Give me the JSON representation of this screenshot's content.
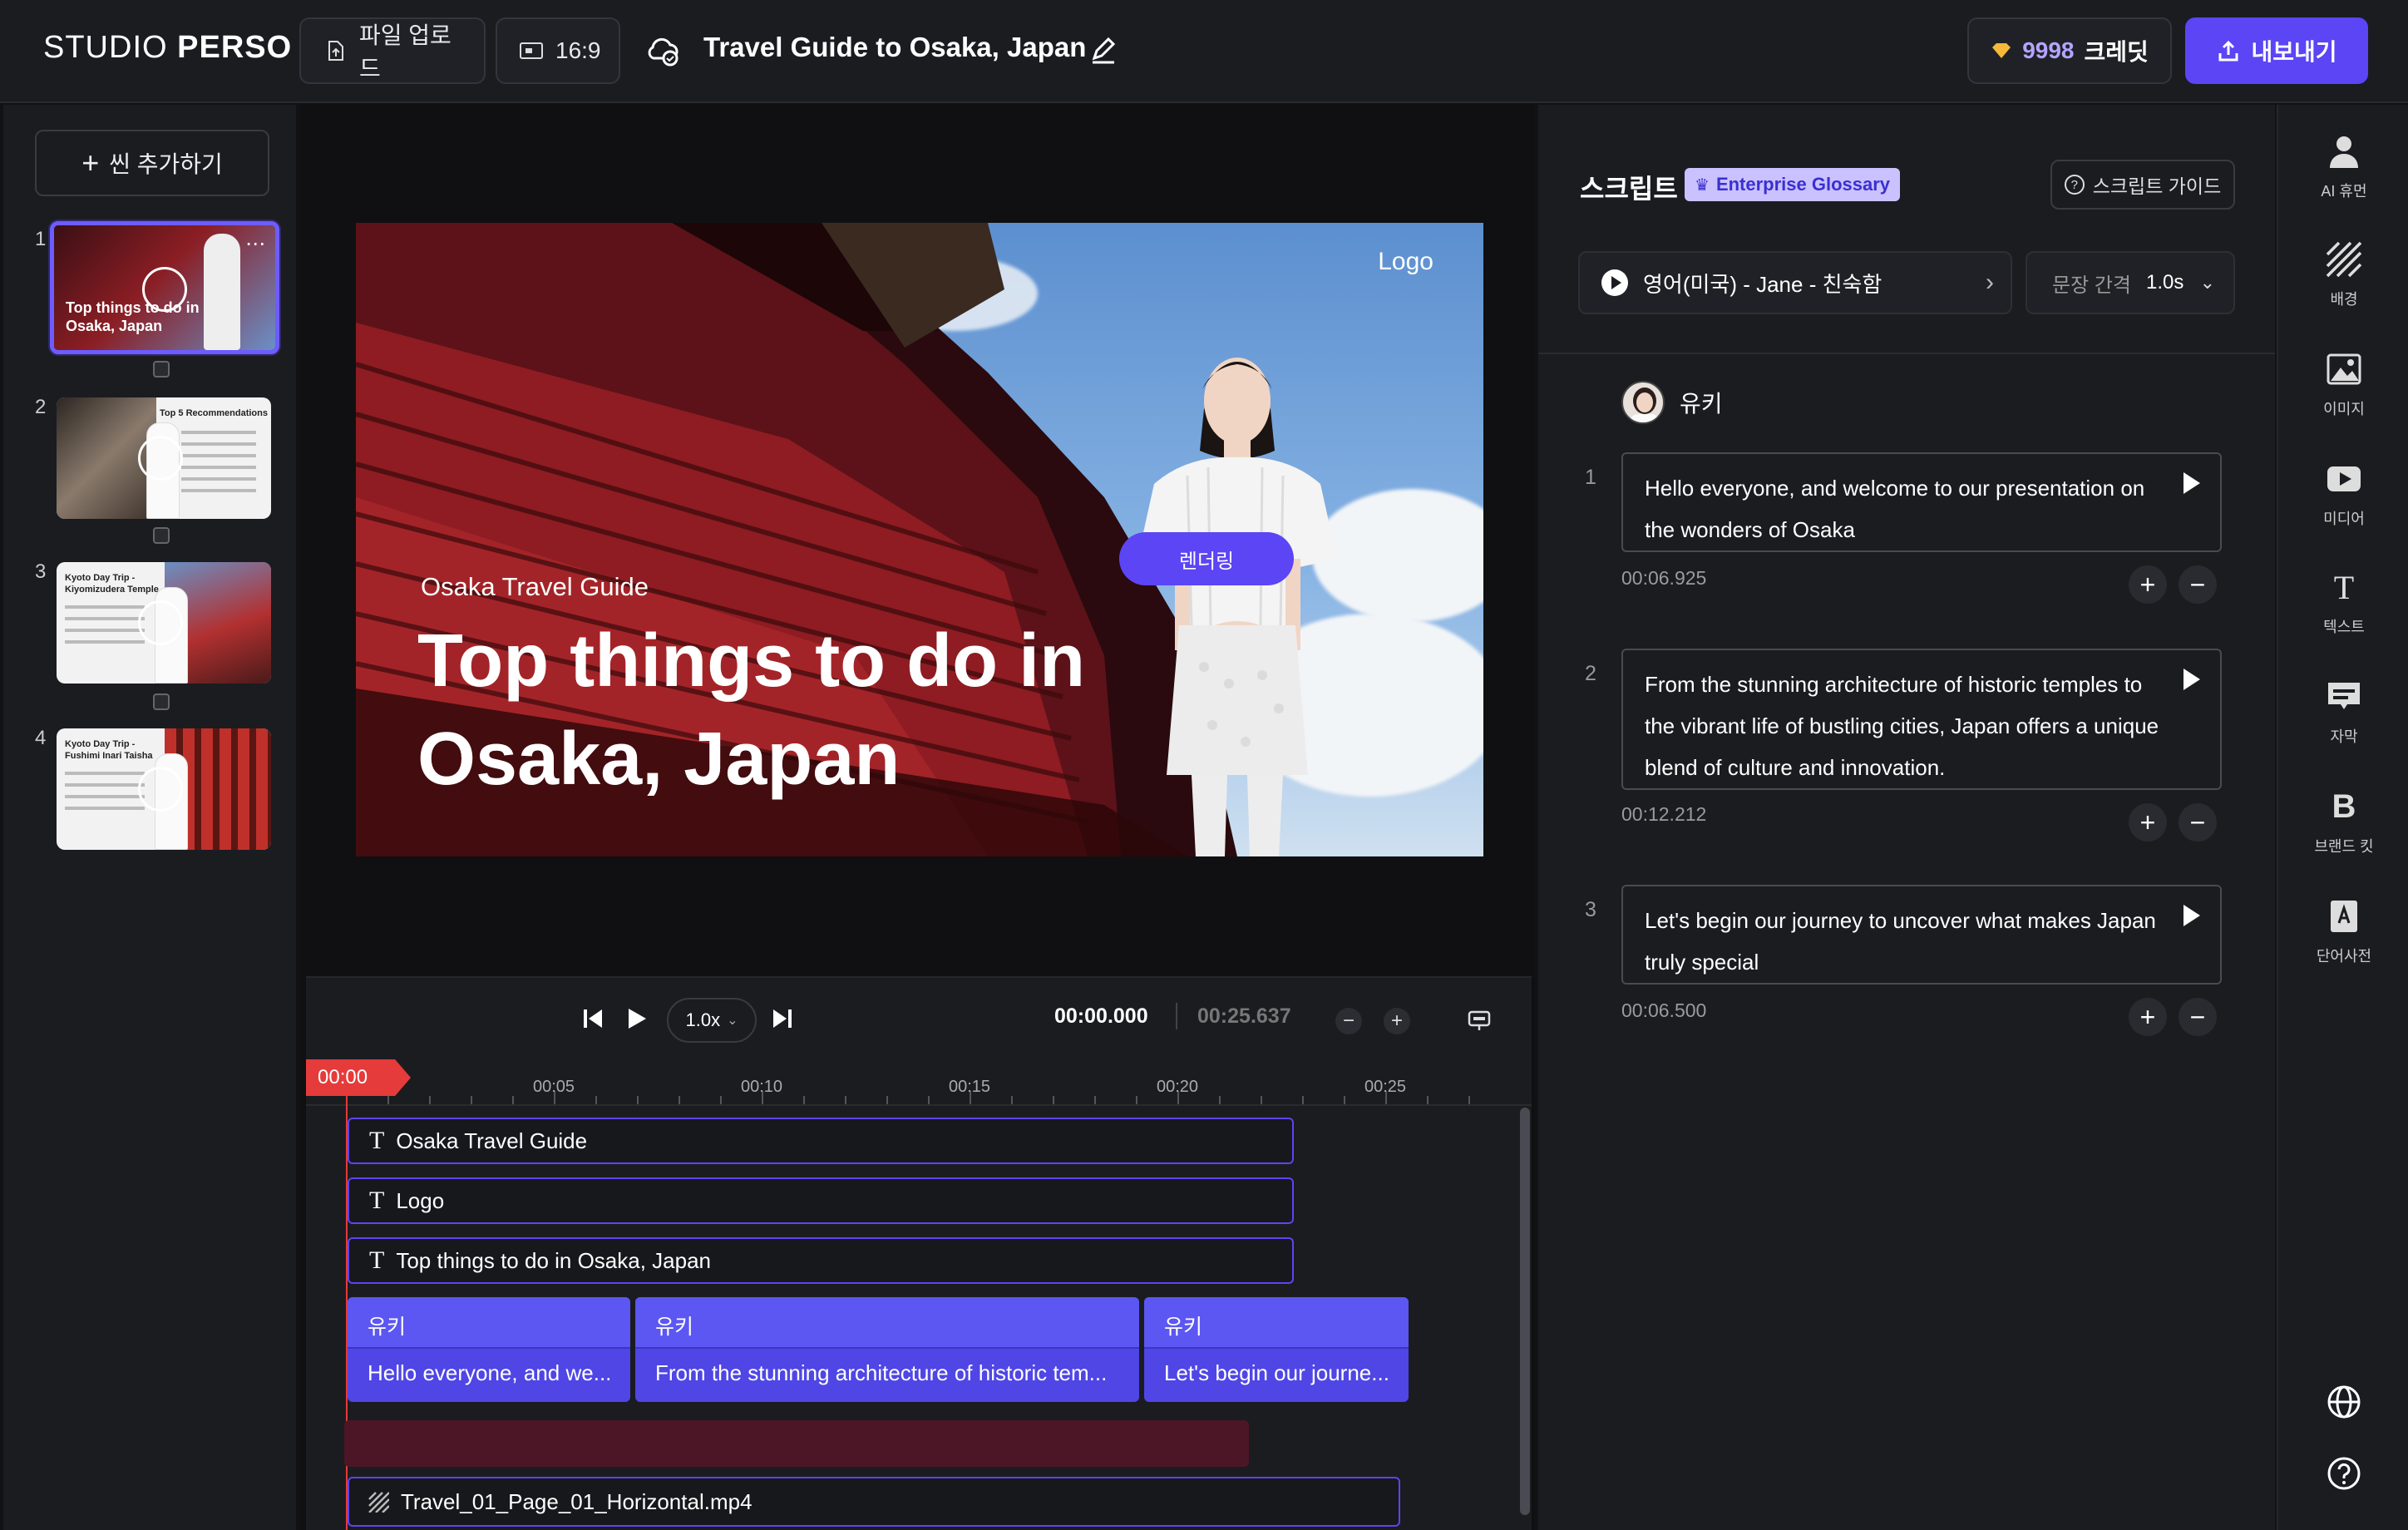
{
  "topbar": {
    "brand_light": "STUDIO",
    "brand_bold": "PERSO",
    "upload_label": "파일 업로드",
    "ratio_label": "16:9",
    "project_title": "Travel Guide to Osaka, Japan",
    "credits_number": "9998",
    "credits_unit": "크레딧",
    "export_label": "내보내기"
  },
  "scenes": {
    "add_label": "씬 추가하기",
    "items": [
      {
        "number": "1",
        "title": "Top things to do in Osaka, Japan"
      },
      {
        "number": "2",
        "title": "Top 5 Recommendations"
      },
      {
        "number": "3",
        "title": "Kyoto Day Trip - Kiyomizudera Temple"
      },
      {
        "number": "4",
        "title": "Kyoto Day Trip - Fushimi Inari Taisha"
      }
    ]
  },
  "canvas": {
    "logo_text": "Logo",
    "subtitle": "Osaka Travel Guide",
    "headline": "Top things to do in Osaka, Japan",
    "render_badge": "렌더링"
  },
  "transport": {
    "speed": "1.0x",
    "current_time": "00:00.000",
    "total_time": "00:25.637"
  },
  "timeline": {
    "playhead": "00:00",
    "ticks": [
      "00:05",
      "00:10",
      "00:15",
      "00:20",
      "00:25"
    ],
    "text_tracks": [
      "Osaka Travel Guide",
      "Logo",
      "Top things to do in Osaka, Japan"
    ],
    "voice_clips": [
      {
        "speaker": "유키",
        "text": "Hello everyone, and we..."
      },
      {
        "speaker": "유키",
        "text": "From the stunning architecture of historic tem..."
      },
      {
        "speaker": "유키",
        "text": "Let's begin our journe..."
      }
    ],
    "video_track": "Travel_01_Page_01_Horizontal.mp4"
  },
  "script": {
    "heading": "스크립트",
    "glossary_badge": "Enterprise Glossary",
    "guide_label": "스크립트 가이드",
    "voice_label": "영어(미국) - Jane - 친숙함",
    "gap_label": "문장 간격",
    "gap_value": "1.0s",
    "speaker_name": "유키",
    "sentences": [
      {
        "no": "1",
        "text": "Hello everyone, and welcome to our presentation on the wonders of Osaka",
        "duration": "00:06.925"
      },
      {
        "no": "2",
        "text": "From the stunning architecture of historic temples to the vibrant life of bustling cities, Japan offers a unique blend of culture and innovation.",
        "duration": "00:12.212"
      },
      {
        "no": "3",
        "text": "Let's begin our journey to uncover what makes Japan truly special",
        "duration": "00:06.500"
      }
    ]
  },
  "sidebar": {
    "items": [
      {
        "label": "AI 휴먼",
        "icon": "person-icon"
      },
      {
        "label": "배경",
        "icon": "background-icon"
      },
      {
        "label": "이미지",
        "icon": "image-icon"
      },
      {
        "label": "미디어",
        "icon": "media-icon"
      },
      {
        "label": "텍스트",
        "icon": "text-icon"
      },
      {
        "label": "자막",
        "icon": "subtitle-icon"
      },
      {
        "label": "브랜드 킷",
        "icon": "brand-kit-icon"
      },
      {
        "label": "단어사전",
        "icon": "dictionary-icon"
      }
    ]
  },
  "colors": {
    "accent": "#5b45f5",
    "playhead": "#e53b3b",
    "background": "#121214"
  }
}
